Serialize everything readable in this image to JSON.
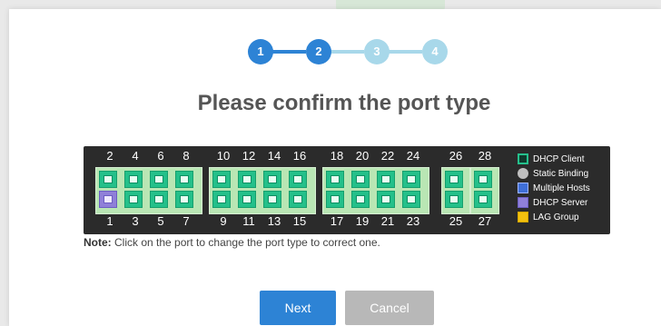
{
  "wizard": {
    "steps": [
      {
        "label": "1",
        "state": "active"
      },
      {
        "label": "2",
        "state": "active"
      },
      {
        "label": "3",
        "state": "inactive"
      },
      {
        "label": "4",
        "state": "inactive"
      }
    ],
    "title": "Please confirm the port type"
  },
  "switch_panel": {
    "top_ports": [
      "2",
      "4",
      "6",
      "8",
      "10",
      "12",
      "14",
      "16",
      "18",
      "20",
      "22",
      "24",
      "26",
      "28"
    ],
    "bottom_ports": [
      "1",
      "3",
      "5",
      "7",
      "9",
      "11",
      "13",
      "15",
      "17",
      "19",
      "21",
      "23",
      "25",
      "27"
    ],
    "port_types": {
      "1": "DHCP Server"
    }
  },
  "legend": [
    {
      "label": "DHCP Client",
      "icon": "dhcp-client-icon",
      "color": "#25c08c"
    },
    {
      "label": "Static Binding",
      "icon": "static-binding-icon",
      "color": "#bfbfbf"
    },
    {
      "label": "Multiple Hosts",
      "icon": "multiple-hosts-icon",
      "color": "#3f6fd8"
    },
    {
      "label": "DHCP Server",
      "icon": "dhcp-server-icon",
      "color": "#8f80d8"
    },
    {
      "label": "LAG Group",
      "icon": "lag-group-icon",
      "color": "#f3c10f"
    }
  ],
  "note": {
    "prefix": "Note:",
    "text": " Click on the port to change the port type to correct one."
  },
  "buttons": {
    "next": "Next",
    "cancel": "Cancel"
  },
  "colors": {
    "step_active": "#2d83d5",
    "step_inactive": "#a8d8ea",
    "port_default": "#24c08a"
  }
}
